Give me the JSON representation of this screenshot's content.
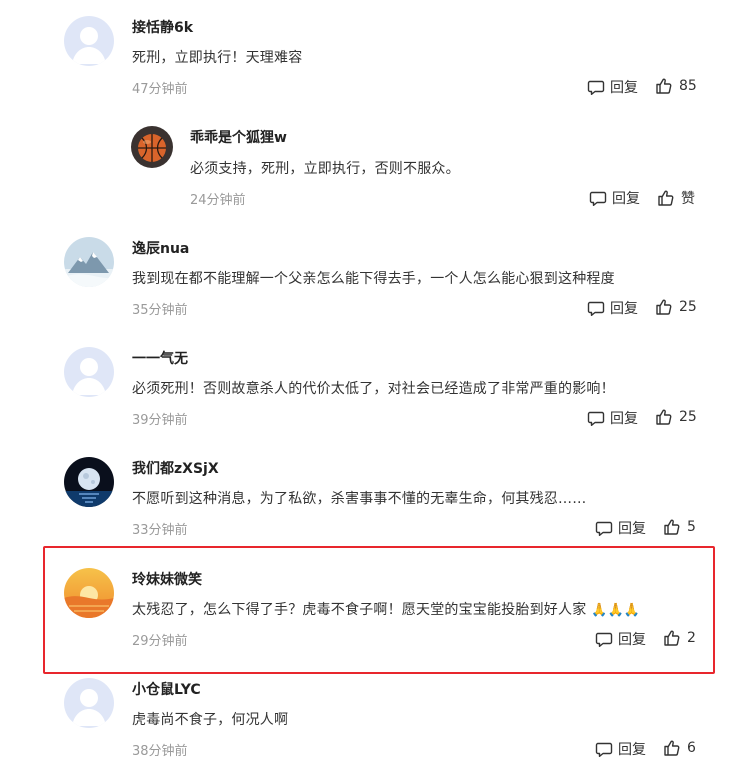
{
  "ui": {
    "reply_label": "回复",
    "highlight_color": "#e8262d"
  },
  "comments": [
    {
      "name": "接恬静6k",
      "text": "死刑，立即执行！天理难容",
      "time": "47分钟前",
      "likes": "85",
      "avatar": "default-avatar"
    },
    {
      "name": "乖乖是个狐狸w",
      "text": "必须支持，死刑，立即执行，否则不服众。",
      "time": "24分钟前",
      "likes": "赞",
      "avatar": "basketball-avatar",
      "is_reply": true
    },
    {
      "name": "逸辰nua",
      "text": "我到现在都不能理解一个父亲怎么能下得去手，一个人怎么能心狠到这种程度",
      "time": "35分钟前",
      "likes": "25",
      "avatar": "snow-mountain-avatar"
    },
    {
      "name": "一一气无",
      "text": "必须死刑！否则故意杀人的代价太低了，对社会已经造成了非常严重的影响！",
      "time": "39分钟前",
      "likes": "25",
      "avatar": "default-avatar"
    },
    {
      "name": "我们都zXSjX",
      "text": "不愿听到这种消息，为了私欲，杀害事事不懂的无辜生命，何其残忍……",
      "time": "33分钟前",
      "likes": "5",
      "avatar": "moon-avatar"
    },
    {
      "name": "玲妹妹微笑",
      "text": "太残忍了，怎么下得了手？虎毒不食子啊！愿天堂的宝宝能投胎到好人家",
      "emoji": "🙏🙏🙏",
      "time": "29分钟前",
      "likes": "2",
      "avatar": "sunset-avatar",
      "highlighted": true
    },
    {
      "name": "小仓鼠LYC",
      "text": "虎毒尚不食子，何况人啊",
      "time": "38分钟前",
      "likes": "6",
      "avatar": "default-avatar"
    }
  ]
}
